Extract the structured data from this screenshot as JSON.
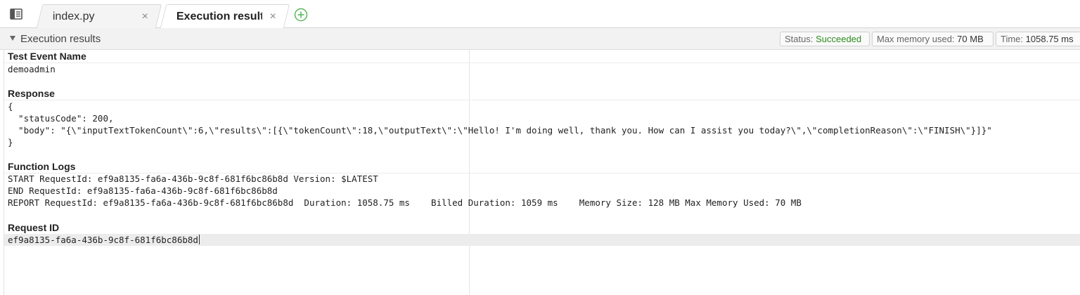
{
  "tabs": [
    {
      "label": "index.py",
      "close": "×"
    },
    {
      "label": "Execution results",
      "close": "×"
    }
  ],
  "header": {
    "title": "Execution results",
    "status_label": "Status:",
    "status_value": "Succeeded",
    "memory_label": "Max memory used:",
    "memory_value": "70 MB",
    "time_label": "Time:",
    "time_value": "1058.75 ms"
  },
  "sections": {
    "test_event": {
      "title": "Test Event Name",
      "value": "demoadmin"
    },
    "response": {
      "title": "Response",
      "lines": [
        "{",
        "  \"statusCode\": 200,",
        "  \"body\": \"{\\\"inputTextTokenCount\\\":6,\\\"results\\\":[{\\\"tokenCount\\\":18,\\\"outputText\\\":\\\"Hello! I'm doing well, thank you. How can I assist you today?\\\",\\\"completionReason\\\":\\\"FINISH\\\"}]}\"",
        "}"
      ]
    },
    "function_logs": {
      "title": "Function Logs",
      "lines": [
        "START RequestId: ef9a8135-fa6a-436b-9c8f-681f6bc86b8d Version: $LATEST",
        "END RequestId: ef9a8135-fa6a-436b-9c8f-681f6bc86b8d",
        "REPORT RequestId: ef9a8135-fa6a-436b-9c8f-681f6bc86b8d  Duration: 1058.75 ms    Billed Duration: 1059 ms    Memory Size: 128 MB Max Memory Used: 70 MB"
      ]
    },
    "request_id": {
      "title": "Request ID",
      "value": "ef9a8135-fa6a-436b-9c8f-681f6bc86b8d"
    }
  },
  "colors": {
    "success": "#2e8b1e",
    "add_icon": "#5cb85c"
  },
  "icons": [
    "panel-toggle-icon",
    "close-icon",
    "add-tab-icon",
    "collapse-caret-icon"
  ]
}
